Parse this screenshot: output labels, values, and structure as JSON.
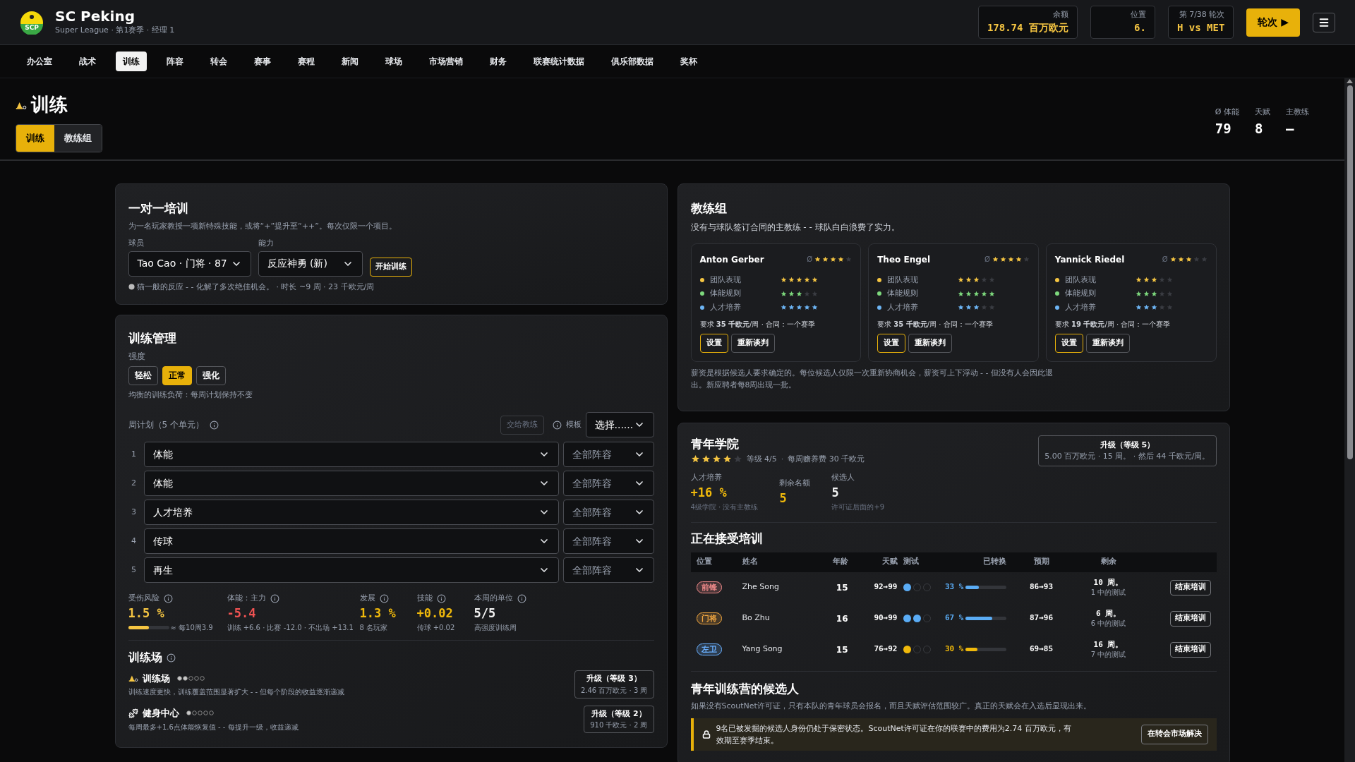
{
  "header": {
    "logo_text": "SCP",
    "club_name": "SC Peking",
    "subtitle": "Super League · 第1赛季 · 经理 1",
    "stats": [
      {
        "label": "余额",
        "value": "178.74 百万欧元"
      },
      {
        "label": "位置",
        "value": "6."
      },
      {
        "label": "第 7/38 轮次",
        "value": "H vs MET"
      }
    ],
    "next_button": "轮次 ▶"
  },
  "nav": [
    {
      "label": "办公室",
      "selected": false
    },
    {
      "label": "战术",
      "selected": false
    },
    {
      "label": "训练",
      "selected": true
    },
    {
      "label": "阵容",
      "selected": false
    },
    {
      "label": "转会",
      "selected": false
    },
    {
      "label": "赛事",
      "selected": false
    },
    {
      "label": "赛程",
      "selected": false
    },
    {
      "label": "新闻",
      "selected": false
    },
    {
      "label": "球场",
      "selected": false
    },
    {
      "label": "市场营销",
      "selected": false
    },
    {
      "label": "财务",
      "selected": false
    },
    {
      "label": "联赛统计数据",
      "selected": false
    },
    {
      "label": "俱乐部数据",
      "selected": false
    },
    {
      "label": "奖杯",
      "selected": false
    }
  ],
  "page": {
    "title": "训练",
    "tabs": [
      {
        "label": "训练",
        "selected": true
      },
      {
        "label": "教练组",
        "selected": false
      }
    ],
    "summary": [
      {
        "label": "Ø 体能",
        "value": "79"
      },
      {
        "label": "天赋",
        "value": "8"
      },
      {
        "label": "主教练",
        "value": "–"
      }
    ]
  },
  "one_on_one": {
    "title": "一对一培训",
    "description": "为一名玩家教授一项新特殊技能，或将“+”提升至“++”。每次仅限一个项目。",
    "player_label": "球员",
    "player_value": "Tao Cao · 门将 · 87",
    "ability_label": "能力",
    "ability_value": "反应神勇 (新)",
    "start_button": "开始训练",
    "note": "猫一般的反应 - - 化解了多次绝佳机会。 · 时长 ~9 周 · 23 千欧元/周"
  },
  "management": {
    "title": "训练管理",
    "intensity_label": "强度",
    "intensity": [
      {
        "label": "轻松",
        "selected": false
      },
      {
        "label": "正常",
        "selected": true
      },
      {
        "label": "强化",
        "selected": false
      }
    ],
    "intensity_note": "均衡的训练负荷：每周计划保持不变",
    "plan_label": "周计划（5 个单元）",
    "handoff_button": "交给教练",
    "template_label": "模板",
    "template_value": "选择......",
    "plan": [
      {
        "index": "1",
        "focus": "体能",
        "group": "全部阵容"
      },
      {
        "index": "2",
        "focus": "体能",
        "group": "全部阵容"
      },
      {
        "index": "3",
        "focus": "人才培养",
        "group": "全部阵容"
      },
      {
        "index": "4",
        "focus": "传球",
        "group": "全部阵容"
      },
      {
        "index": "5",
        "focus": "再生",
        "group": "全部阵容"
      }
    ],
    "metrics": [
      {
        "label": "受伤风险",
        "value": "1.5 %",
        "note": "≈ 每10周3.9",
        "color": "#f5c542",
        "level": 0.5
      },
      {
        "label": "体能：主力",
        "value": "-5.4",
        "note": "训练 +6.6 · 比赛 -12.0 · 不出场 +13.1",
        "color": "#f05252"
      },
      {
        "label": "发展",
        "value": "1.3 %",
        "note": "8 名玩家",
        "color": "#f0b90b"
      },
      {
        "label": "技能",
        "value": "+0.02",
        "note": "传球 +0.02",
        "color": "#f0b90b"
      },
      {
        "label": "本周的单位",
        "value": "5/5",
        "note": "高强度训练周",
        "color": "#f2f2f2"
      }
    ]
  },
  "facilities": {
    "title": "训练场",
    "items": [
      {
        "kind": "field",
        "name": "训练场",
        "stars": 2,
        "description": "训练速度更快，训练覆盖范围显著扩大 - - 但每个阶段的收益逐渐递减",
        "upgrade_title": "升级（等级 3）",
        "upgrade_detail": "2.46 百万欧元 · 3 周"
      },
      {
        "kind": "gym",
        "name": "健身中心",
        "stars": 1,
        "description": "每周最多+1.6点体能恢复值 - - 每提升一级，收益递减",
        "upgrade_title": "升级（等级 2）",
        "upgrade_detail": "910 千欧元 · 2 周"
      }
    ]
  },
  "coaches": {
    "title": "教练组",
    "warning": "没有与球队签订合同的主教练 - - 球队白白浪费了实力。",
    "cards": [
      {
        "name": "Anton Gerber",
        "rating_label": "Ø",
        "stars": 4,
        "skills": [
          {
            "label": "团队表现",
            "stars": 5,
            "color": "#f5c542"
          },
          {
            "label": "体能规则",
            "stars": 3,
            "color": "#7dd87d"
          },
          {
            "label": "人才培养",
            "stars": 5,
            "color": "#6db5f5"
          }
        ],
        "salary": "要求 **35 千欧元**/周 · 合同：一个赛季",
        "set_button": "设置",
        "renegotiate_button": "重新谈判"
      },
      {
        "name": "Theo Engel",
        "rating_label": "Ø",
        "stars": 4,
        "skills": [
          {
            "label": "团队表现",
            "stars": 3,
            "color": "#f5c542"
          },
          {
            "label": "体能规则",
            "stars": 5,
            "color": "#7dd87d"
          },
          {
            "label": "人才培养",
            "stars": 3,
            "color": "#6db5f5"
          }
        ],
        "salary": "要求 **35 千欧元**/周 · 合同：一个赛季",
        "set_button": "设置",
        "renegotiate_button": "重新谈判"
      },
      {
        "name": "Yannick Riedel",
        "rating_label": "Ø",
        "stars": 3,
        "skills": [
          {
            "label": "团队表现",
            "stars": 3,
            "color": "#f5c542"
          },
          {
            "label": "体能规则",
            "stars": 3,
            "color": "#7dd87d"
          },
          {
            "label": "人才培养",
            "stars": 3,
            "color": "#6db5f5"
          }
        ],
        "salary": "要求 **19 千欧元**/周 · 合同：一个赛季",
        "set_button": "设置",
        "renegotiate_button": "重新谈判"
      }
    ],
    "footnote": "薪资是根据候选人要求确定的。每位候选人仅限一次重新协商机会，薪资可上下浮动 - - 但没有人会因此退出。新应聘者每8周出现一批。"
  },
  "youth": {
    "title": "青年学院",
    "stars": 4,
    "level_text": "等级 4/5",
    "separator": "·",
    "fee": "每周赡养费 30 千欧元",
    "upgrade_title": "升级（等级 5）",
    "upgrade_detail": "5.00 百万欧元 · 15 周。 · 然后 44 千欧元/周。",
    "stats": [
      {
        "label": "人才培养",
        "value": "+16 %",
        "note": "4级学院 · 没有主教练",
        "color": "#f0b90b"
      },
      {
        "label": "剩余名额",
        "value": "5",
        "color": "#f0b90b"
      },
      {
        "label": "候选人",
        "value": "5",
        "note": "许可证后面的+9",
        "color": "#f2f2f2"
      }
    ],
    "training_title": "正在接受培训",
    "columns": [
      "位置",
      "姓名",
      "年龄",
      "天赋",
      "测试",
      "已转换",
      "预期",
      "剩余"
    ],
    "rows": [
      {
        "position": {
          "label": "前锋",
          "color": "#f08a8a"
        },
        "name": "Zhe Song",
        "age": "15",
        "talent": "92→99",
        "tests": [
          {
            "passed": true
          },
          {
            "passed": false
          },
          {
            "passed": false
          }
        ],
        "converted": "33 %",
        "level": 0.33,
        "color": "#5aacf5",
        "projected": "86→93",
        "remaining": "10 周。",
        "remaining_note": "1 中的测试",
        "button": "结束培训"
      },
      {
        "position": {
          "label": "门将",
          "color": "#f0a640"
        },
        "name": "Bo Zhu",
        "age": "16",
        "talent": "90→99",
        "tests": [
          {
            "passed": true
          },
          {
            "passed": true
          },
          {
            "passed": false
          }
        ],
        "converted": "67 %",
        "level": 0.67,
        "color": "#5aacf5",
        "projected": "87→96",
        "remaining": "6 周。",
        "remaining_note": "6 中的测试",
        "button": "结束培训"
      },
      {
        "position": {
          "label": "左卫",
          "color": "#6ab0ff"
        },
        "name": "Yang Song",
        "age": "15",
        "talent": "76→92",
        "tests": [
          {
            "passed": true
          },
          {
            "passed": false
          },
          {
            "passed": false
          }
        ],
        "converted": "30 %",
        "level": 0.3,
        "color": "#f0b90b",
        "projected": "69→85",
        "remaining": "16 周。",
        "remaining_note": "7 中的测试",
        "button": "结束培训"
      }
    ],
    "candidates_title": "青年训练营的候选人",
    "candidates_description": "如果没有ScoutNet许可证，只有本队的青年球员会报名，而且天赋评估范围较广。真正的天赋会在入选后显现出来。",
    "notice": "9名已被发掘的候选人身份仍处于保密状态。ScoutNet许可证在你的联赛中的费用为2.74 百万欧元，有效期至赛季结束。",
    "notice_button": "在转会市场解决"
  }
}
